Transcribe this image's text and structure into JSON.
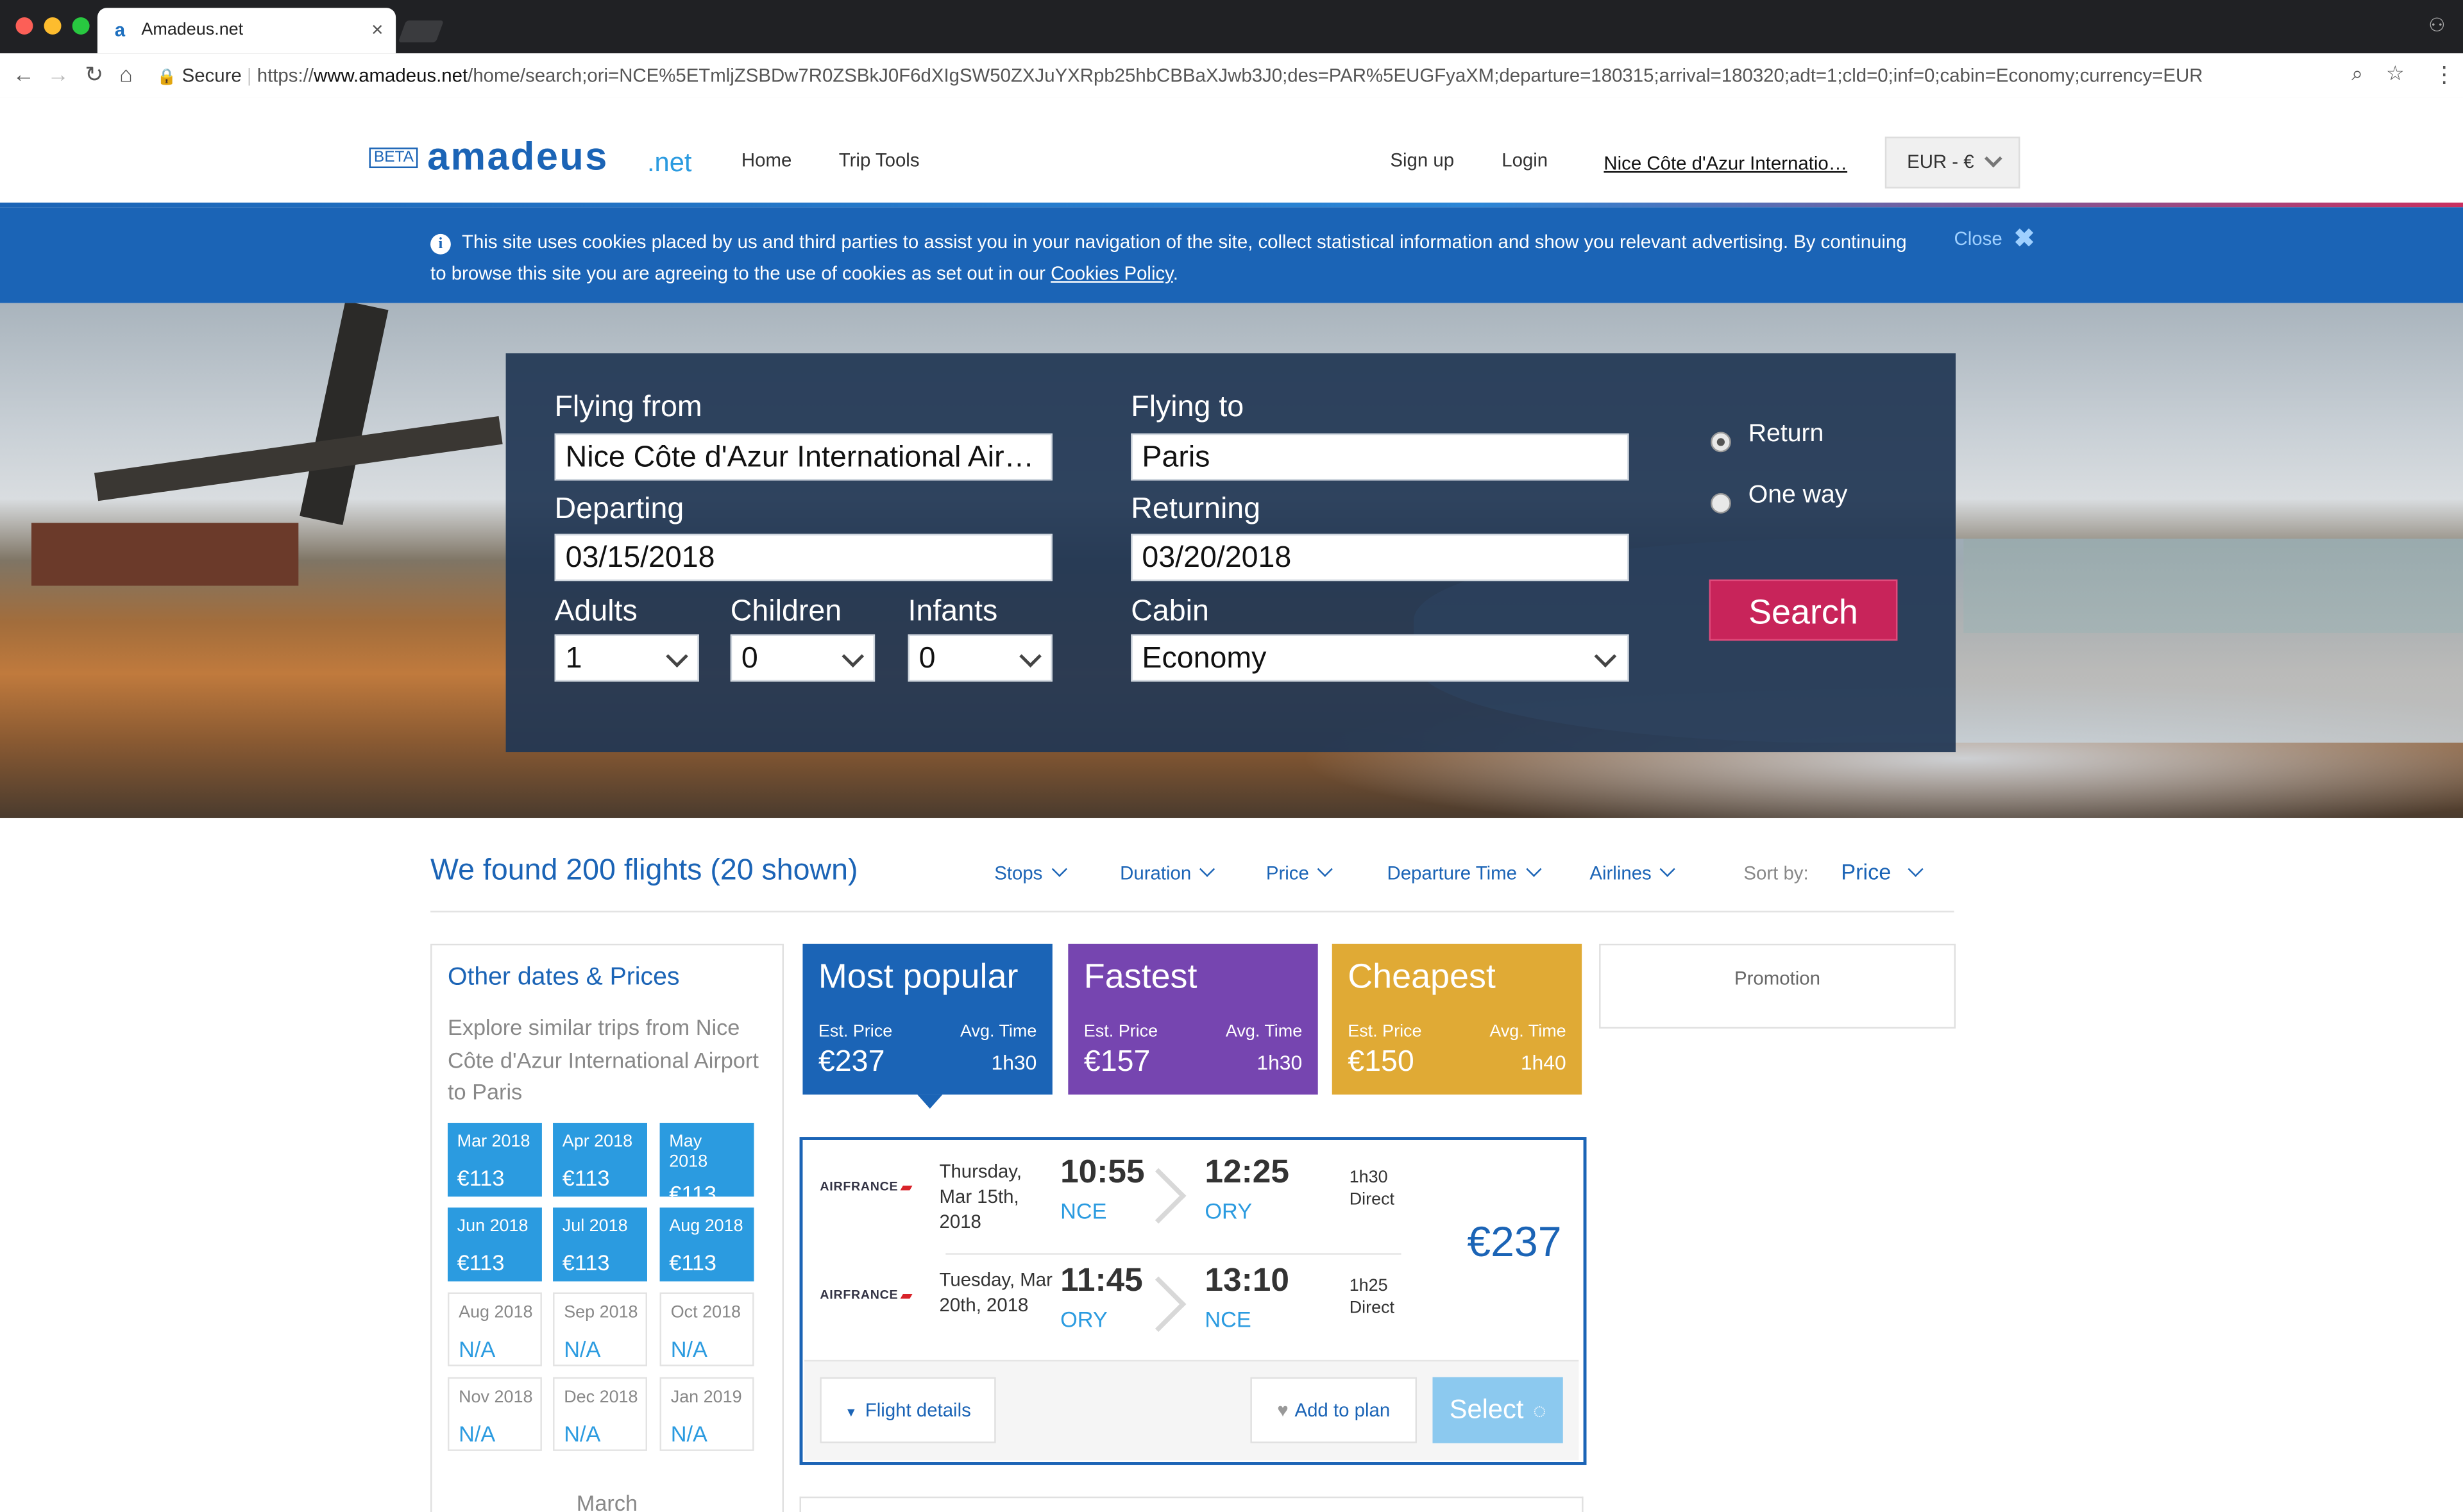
{
  "browser": {
    "tab_title": "Amadeus.net",
    "tab_favicon": "a",
    "tab_close": "×",
    "secure_label": "Secure",
    "url_scheme": "https://",
    "url_host": "www.amadeus.net",
    "url_path": "/home/search;ori=NCE%5ETmljZSBDw7R0ZSBkJ0F6dXIgSW50ZXJuYXRpb25hbCBBaXJwb3J0;des=PAR%5EUGFyaXM;departure=180315;arrival=180320;adt=1;cld=0;inf=0;cabin=Economy;currency=EUR"
  },
  "header": {
    "beta": "BETA",
    "logo": "amadeus",
    "logo_suffix": ".net",
    "nav": [
      "Home",
      "Trip Tools"
    ],
    "signup": "Sign up",
    "login": "Login",
    "airport_link": "Nice Côte d'Azur Internatio…",
    "currency": "EUR - €"
  },
  "cookie_banner": {
    "text": "This site uses cookies placed by us and third parties to assist you in your navigation of the site, collect statistical information and show you relevant advertising. By continuing to browse this site you are agreeing to the use of cookies as set out in our ",
    "policy_link": "Cookies Policy",
    "close": "Close"
  },
  "search": {
    "from_label": "Flying from",
    "from_value": "Nice Côte d'Azur International Air…",
    "to_label": "Flying to",
    "to_value": "Paris",
    "departing_label": "Departing",
    "departing_value": "03/15/2018",
    "returning_label": "Returning",
    "returning_value": "03/20/2018",
    "adults_label": "Adults",
    "adults_value": "1",
    "children_label": "Children",
    "children_value": "0",
    "infants_label": "Infants",
    "infants_value": "0",
    "cabin_label": "Cabin",
    "cabin_value": "Economy",
    "trip_return": "Return",
    "trip_oneway": "One way",
    "selected_trip": "Return",
    "button": "Search"
  },
  "results": {
    "found": "We found 200 flights (20 shown)",
    "filters": [
      "Stops",
      "Duration",
      "Price",
      "Departure Time",
      "Airlines"
    ],
    "sort_label": "Sort by:",
    "sort_value": "Price"
  },
  "other_dates": {
    "title": "Other dates & Prices",
    "description": "Explore similar trips from Nice Côte d'Azur International Airport to Paris",
    "months": [
      {
        "month": "Mar 2018",
        "price": "€113",
        "available": true
      },
      {
        "month": "Apr 2018",
        "price": "€113",
        "available": true
      },
      {
        "month": "May 2018",
        "price": "€113",
        "available": true
      },
      {
        "month": "Jun 2018",
        "price": "€113",
        "available": true
      },
      {
        "month": "Jul 2018",
        "price": "€113",
        "available": true
      },
      {
        "month": "Aug 2018",
        "price": "€113",
        "available": true
      },
      {
        "month": "Aug 2018",
        "price": "N/A",
        "available": false
      },
      {
        "month": "Sep 2018",
        "price": "N/A",
        "available": false
      },
      {
        "month": "Oct 2018",
        "price": "N/A",
        "available": false
      },
      {
        "month": "Nov 2018",
        "price": "N/A",
        "available": false
      },
      {
        "month": "Dec 2018",
        "price": "N/A",
        "available": false
      },
      {
        "month": "Jan 2019",
        "price": "N/A",
        "available": false
      }
    ],
    "footer": "March"
  },
  "categories": [
    {
      "title": "Most popular",
      "price_label": "Est. Price",
      "price": "€237",
      "time_label": "Avg. Time",
      "time": "1h30",
      "color": "#1b64b6"
    },
    {
      "title": "Fastest",
      "price_label": "Est. Price",
      "price": "€157",
      "time_label": "Avg. Time",
      "time": "1h30",
      "color": "#7645b0"
    },
    {
      "title": "Cheapest",
      "price_label": "Est. Price",
      "price": "€150",
      "time_label": "Avg. Time",
      "time": "1h40",
      "color": "#e0aa35"
    }
  ],
  "promotion": "Promotion",
  "flight": {
    "airline": "AIRFRANCE",
    "outbound": {
      "date": "Thursday, Mar 15th, 2018",
      "dep_time": "10:55",
      "dep_airport": "NCE",
      "arr_time": "12:25",
      "arr_airport": "ORY",
      "duration": "1h30",
      "stops": "Direct"
    },
    "inbound": {
      "date": "Tuesday, Mar 20th, 2018",
      "dep_time": "11:45",
      "dep_airport": "ORY",
      "arr_time": "13:10",
      "arr_airport": "NCE",
      "duration": "1h25",
      "stops": "Direct"
    },
    "price": "€237",
    "details_button": "Flight details",
    "plan_button": "Add to plan",
    "select_button": "Select"
  },
  "colors": {
    "brand_blue": "#1b64b6",
    "accent_pink": "#c8245a",
    "light_blue": "#2b9be0"
  }
}
